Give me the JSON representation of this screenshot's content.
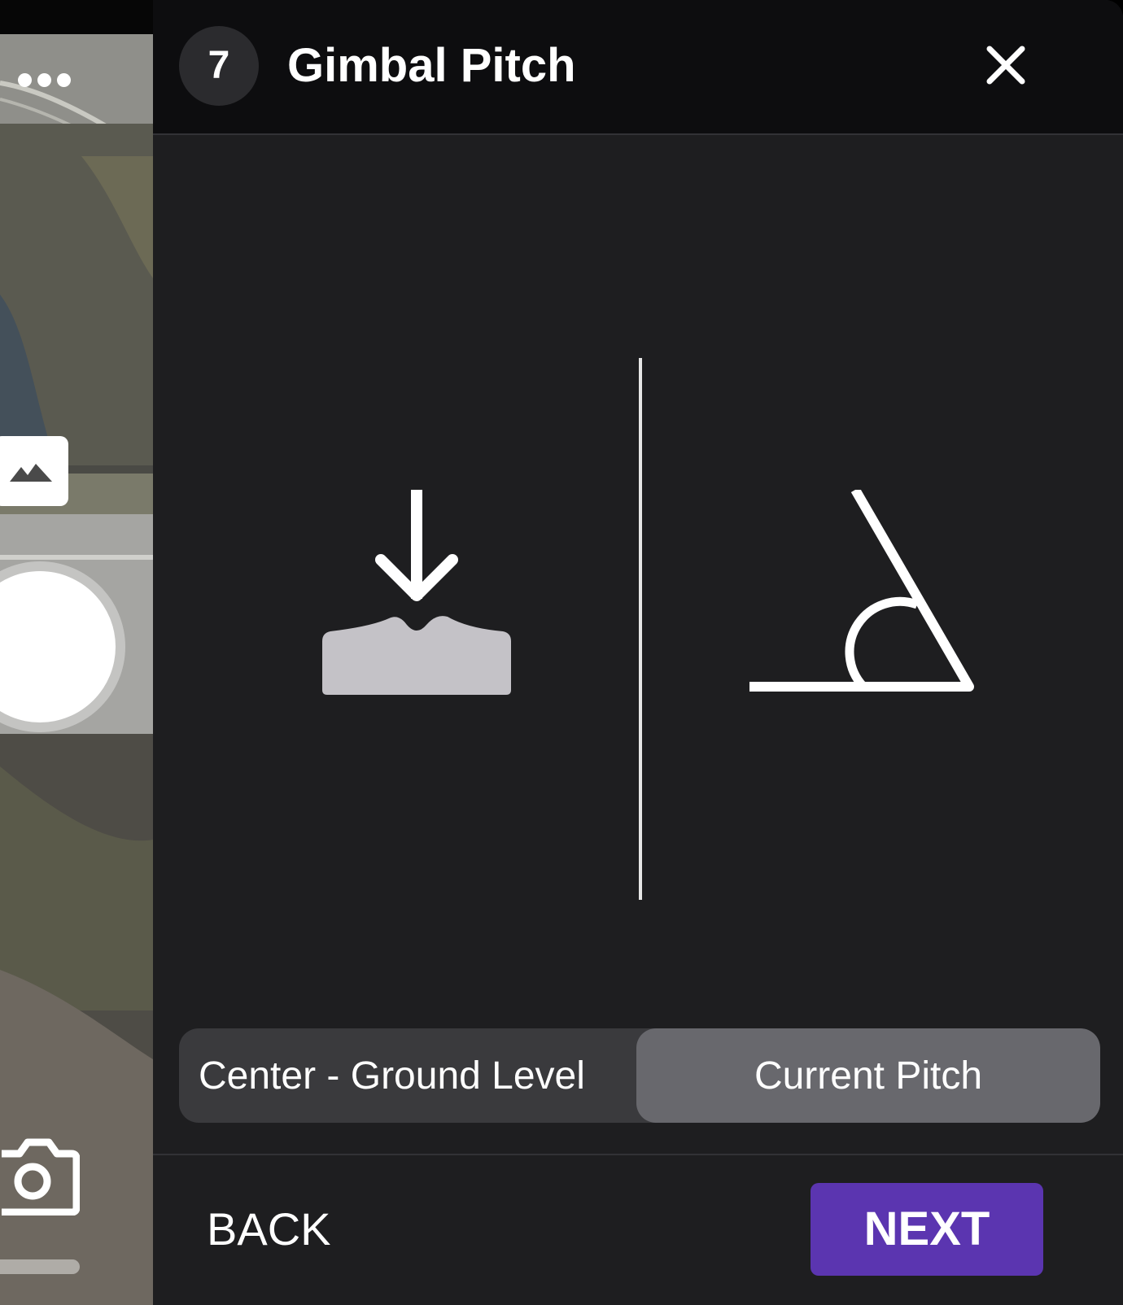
{
  "dialog": {
    "step_number": "7",
    "title": "Gimbal Pitch",
    "close_icon": "close-icon"
  },
  "illustrations": {
    "left_icon": "ground-level-icon",
    "right_icon": "current-pitch-icon"
  },
  "segmented_control": {
    "options": [
      "Center - Ground Level",
      "Current Pitch"
    ],
    "selected": "Current Pitch"
  },
  "footer": {
    "back_label": "BACK",
    "next_label": "NEXT"
  },
  "colors": {
    "panel_background": "#1e1e20",
    "header_background": "#0d0d0f",
    "segment_selected": "#68686d",
    "segment_background": "#3a3a3d",
    "next_button": "#5b35b0"
  },
  "camera_strip": {
    "icons": [
      "more-dots-icon",
      "gallery-icon",
      "shutter-button",
      "camera-icon"
    ]
  }
}
